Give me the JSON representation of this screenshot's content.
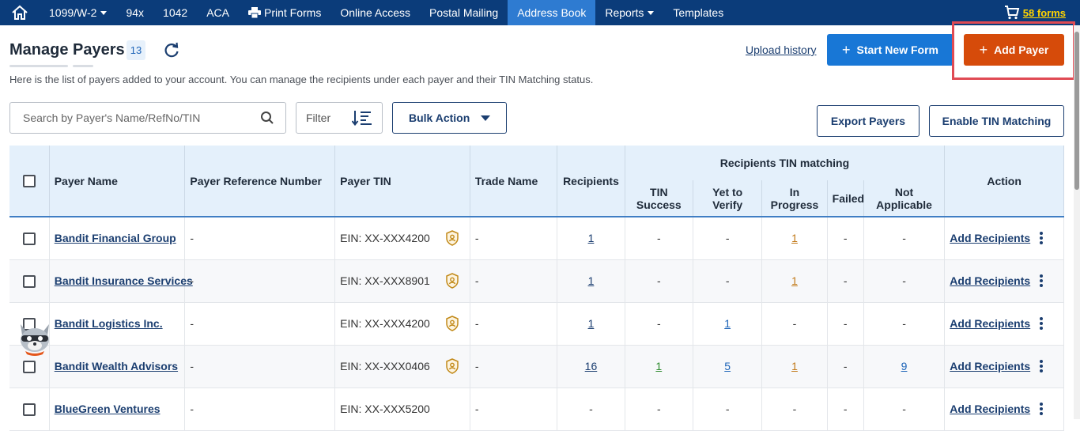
{
  "nav": {
    "items": [
      {
        "label": "1099/W-2",
        "caret": true
      },
      {
        "label": "94x"
      },
      {
        "label": "1042"
      },
      {
        "label": "ACA"
      },
      {
        "label": "Print Forms",
        "icon": "printer-icon"
      },
      {
        "label": "Online Access"
      },
      {
        "label": "Postal Mailing"
      },
      {
        "label": "Address Book",
        "active": true
      },
      {
        "label": "Reports",
        "caret": true
      },
      {
        "label": "Templates"
      }
    ],
    "cart_label": "58 forms"
  },
  "header": {
    "title": "Manage Payers",
    "count": "13",
    "subtitle": "Here is the list of payers added to your account. You can manage the recipients under each payer and their TIN Matching status.",
    "upload_history": "Upload history",
    "start_new_form": "Start New Form",
    "add_payer": "Add Payer"
  },
  "toolbar": {
    "search_placeholder": "Search by Payer's Name/RefNo/TIN",
    "filter_label": "Filter",
    "bulk_action": "Bulk Action",
    "export_payers": "Export Payers",
    "enable_tin": "Enable TIN Matching"
  },
  "table": {
    "headers": {
      "payer_name": "Payer Name",
      "ref": "Payer Reference Number",
      "tin": "Payer TIN",
      "trade": "Trade Name",
      "recipients": "Recipients",
      "tin_group": "Recipients TIN matching",
      "tin_success": "TIN Success",
      "yet_to_verify": "Yet to Verify",
      "in_progress": "In Progress",
      "failed": "Failed",
      "not_applicable": "Not Applicable",
      "action": "Action"
    },
    "rows": [
      {
        "name": "Bandit Financial Group",
        "ref": "-",
        "tin": "EIN: XX-XXX4200",
        "trade": "-",
        "recipients": "1",
        "success": "-",
        "verify": "-",
        "progress": "1",
        "failed": "-",
        "na": "-",
        "action": "Add Recipients"
      },
      {
        "name": "Bandit Insurance Services",
        "ref": "-",
        "tin": "EIN: XX-XXX8901",
        "trade": "-",
        "recipients": "1",
        "success": "-",
        "verify": "-",
        "progress": "1",
        "failed": "-",
        "na": "-",
        "action": "Add Recipients"
      },
      {
        "name": "Bandit Logistics Inc.",
        "ref": "-",
        "tin": "EIN: XX-XXX4200",
        "trade": "-",
        "recipients": "1",
        "success": "-",
        "verify": "1",
        "progress": "-",
        "failed": "-",
        "na": "-",
        "action": "Add Recipients"
      },
      {
        "name": "Bandit Wealth Advisors",
        "ref": "-",
        "tin": "EIN: XX-XXX0406",
        "trade": "-",
        "recipients": "16",
        "success": "1",
        "verify": "5",
        "progress": "1",
        "failed": "-",
        "na": "9",
        "action": "Add Recipients"
      },
      {
        "name": "BlueGreen Ventures",
        "ref": "-",
        "tin": "EIN: XX-XXX5200",
        "trade": "-",
        "recipients": "-",
        "success": "-",
        "verify": "-",
        "progress": "-",
        "failed": "-",
        "na": "-",
        "action": "Add Recipients"
      }
    ]
  },
  "colors": {
    "nav_bg": "#0b3c7a",
    "nav_active": "#2e7bd1",
    "primary_button": "#1877d6",
    "add_payer_button": "#d64b0a",
    "highlight": "#e04b54",
    "link": "#1b3e70"
  }
}
